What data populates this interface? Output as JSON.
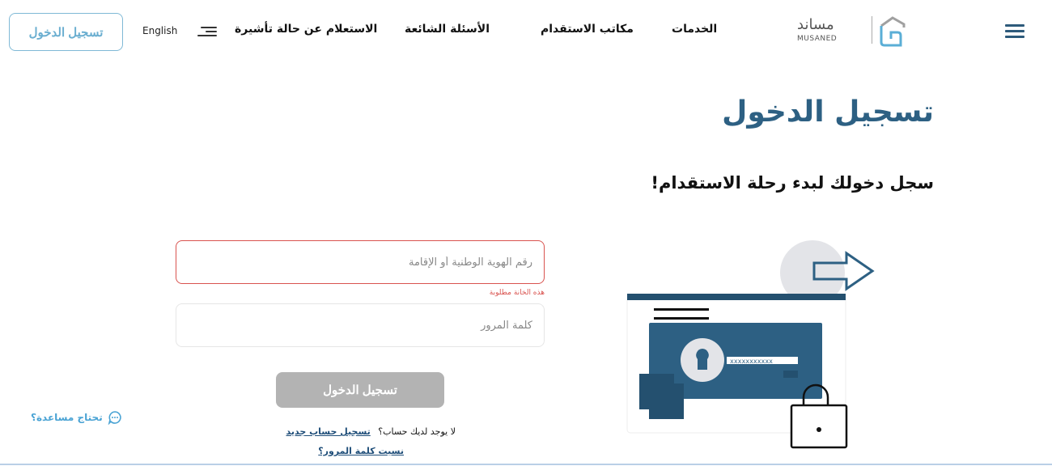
{
  "header": {
    "login_button": "تسجيل الدخول",
    "language_label": "English",
    "language_icon": "menu-lines-icon",
    "nav": [
      {
        "label": "الاستعلام عن حالة تأشيرة"
      },
      {
        "label": "الأسئلة الشائعة"
      },
      {
        "label": "مكاتب الاستقدام"
      },
      {
        "label": "الخدمات"
      }
    ],
    "logo": {
      "arabic": "مساند",
      "english": "MUSANED"
    },
    "menu_icon": "hamburger-icon"
  },
  "hero": {
    "title": "تسجيل الدخول",
    "subtitle": "سجل دخولك لبدء رحلة الاستقدام!"
  },
  "form": {
    "id_field": {
      "placeholder": "رقم الهوية الوطنية أو الإقامة",
      "value": "",
      "error": "هذه الخانة مطلوبة"
    },
    "password_field": {
      "placeholder": "كلمة المرور",
      "value": ""
    },
    "submit_label": "تسجيل الدخول",
    "no_account_text": "لا يوجد لديك حساب؟",
    "register_link": "تسجيل حساب جديد",
    "forgot_link": "نسيت كلمة المرور؟"
  },
  "help": {
    "label": "تحتاج مساعدة؟",
    "icon": "chat-bubble-icon"
  },
  "illustration": {
    "masked_password": "xxxxxxxxxxx"
  },
  "colors": {
    "primary": "#2d6083",
    "accent": "#6aaed0",
    "error": "#d9534f",
    "button_disabled": "#b3b3b3",
    "link": "#1f4e79"
  }
}
